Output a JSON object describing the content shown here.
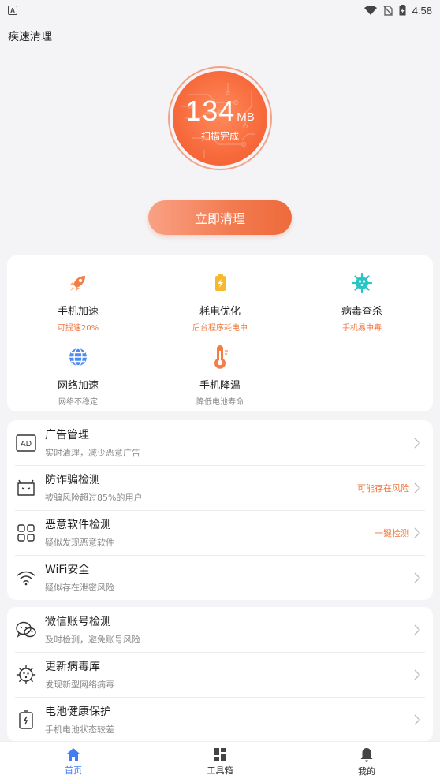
{
  "status_bar": {
    "time": "4:58",
    "left_indicator": "A"
  },
  "app": {
    "title": "疾速清理"
  },
  "scan": {
    "size_value": "134",
    "size_unit": "MB",
    "status": "扫描完成"
  },
  "clean_button": {
    "label": "立即清理"
  },
  "tools": [
    {
      "label": "手机加速",
      "sub": "可提速20%",
      "icon": "rocket-icon",
      "sub_color": "orange"
    },
    {
      "label": "耗电优化",
      "sub": "后台程序耗电中",
      "icon": "battery-icon",
      "sub_color": "orange"
    },
    {
      "label": "病毒查杀",
      "sub": "手机易中毒",
      "icon": "virus-icon",
      "sub_color": "orange"
    },
    {
      "label": "网络加速",
      "sub": "网络不稳定",
      "icon": "globe-icon",
      "sub_color": "gray"
    },
    {
      "label": "手机降温",
      "sub": "降低电池寿命",
      "icon": "thermometer-icon",
      "sub_color": "gray"
    }
  ],
  "security_list": [
    {
      "title": "广告管理",
      "sub": "实时清理，减少恶意广告",
      "right": "",
      "icon": "ad-icon"
    },
    {
      "title": "防诈骗检测",
      "sub": "被骗风险超过85%的用户",
      "right": "可能存在风险",
      "icon": "robot-face-icon"
    },
    {
      "title": "恶意软件检测",
      "sub": "疑似发现恶意软件",
      "right": "一键检测",
      "icon": "apps-grid-icon"
    },
    {
      "title": "WiFi安全",
      "sub": "疑似存在泄密风险",
      "right": "",
      "icon": "wifi-icon"
    }
  ],
  "other_list": [
    {
      "title": "微信账号检测",
      "sub": "及时检测，避免账号风险",
      "icon": "wechat-icon"
    },
    {
      "title": "更新病毒库",
      "sub": "发现新型网络病毒",
      "icon": "virus-outline-icon"
    },
    {
      "title": "电池健康保护",
      "sub": "手机电池状态较差",
      "icon": "battery-outline-icon"
    }
  ],
  "bottom_nav": [
    {
      "label": "首页",
      "icon": "home-icon",
      "active": true
    },
    {
      "label": "工具箱",
      "icon": "toolbox-icon",
      "active": false
    },
    {
      "label": "我的",
      "icon": "bell-icon",
      "active": false
    }
  ],
  "colors": {
    "accent": "#f0763f",
    "nav_active": "#3f7ef5"
  }
}
